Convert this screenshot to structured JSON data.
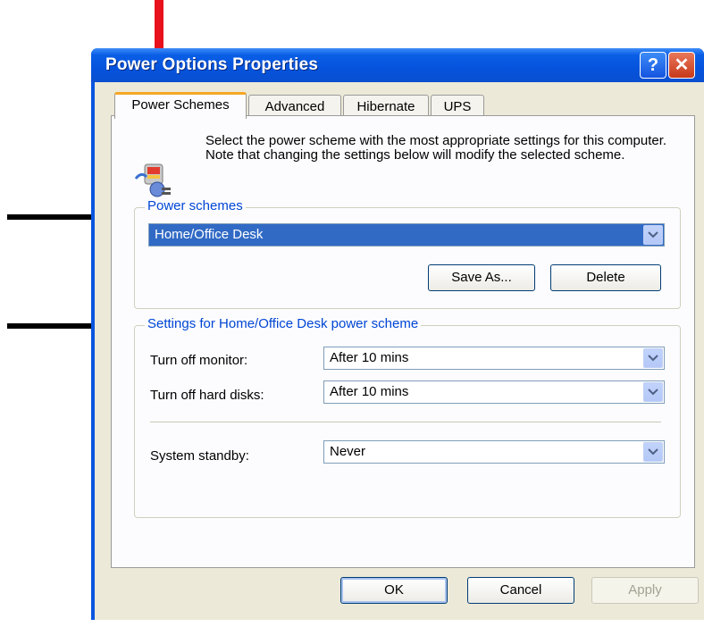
{
  "window": {
    "title": "Power Options Properties",
    "help_glyph": "?",
    "close_glyph": "✕"
  },
  "tabs": [
    {
      "label": "Power Schemes",
      "active": true
    },
    {
      "label": "Advanced",
      "active": false
    },
    {
      "label": "Hibernate",
      "active": false
    },
    {
      "label": "UPS",
      "active": false
    }
  ],
  "intro": {
    "text": "Select the power scheme with the most appropriate settings for this computer. Note that changing the settings below will modify the selected scheme."
  },
  "schemes_group": {
    "legend": "Power schemes",
    "selected": "Home/Office Desk",
    "save_as_label": "Save As...",
    "delete_label": "Delete"
  },
  "settings_group": {
    "legend": "Settings for Home/Office Desk power scheme",
    "monitor_label": "Turn off monitor:",
    "monitor_value": "After 10 mins",
    "disks_label": "Turn off hard disks:",
    "disks_value": "After 10 mins",
    "standby_label": "System standby:",
    "standby_value": "Never"
  },
  "footer": {
    "ok_label": "OK",
    "cancel_label": "Cancel",
    "apply_label": "Apply"
  },
  "colors": {
    "titlebar": "#0553dc",
    "legend_text": "#0046d5",
    "selection": "#316ac5",
    "annotation_red": "#e8121c",
    "annotation_black": "#000000"
  }
}
